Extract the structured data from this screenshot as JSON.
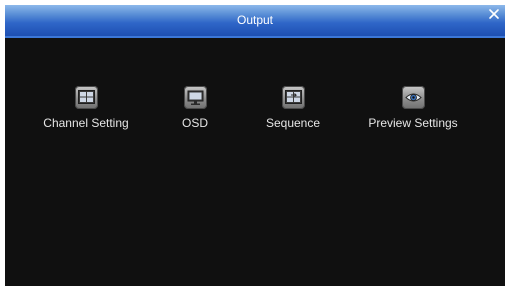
{
  "window": {
    "title": "Output",
    "close_icon": "close-icon"
  },
  "menu": {
    "items": [
      {
        "label": "Channel Setting",
        "icon": "channel-setting-icon"
      },
      {
        "label": "OSD",
        "icon": "monitor-icon"
      },
      {
        "label": "Sequence",
        "icon": "sequence-icon"
      },
      {
        "label": "Preview Settings",
        "icon": "eye-icon"
      }
    ]
  },
  "colors": {
    "titlebar": "#2f66c8",
    "background": "#101010",
    "text": "#e6e6e6"
  }
}
